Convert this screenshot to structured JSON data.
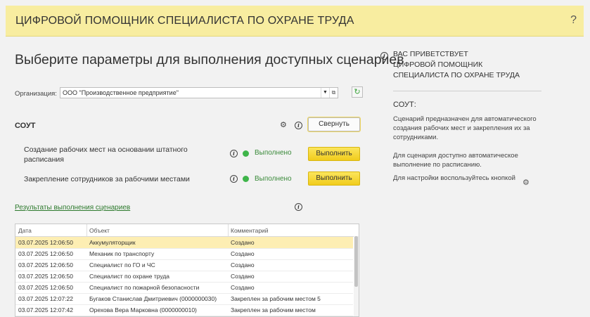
{
  "header": {
    "title": "ЦИФРОВОЙ ПОМОЩНИК СПЕЦИАЛИСТА ПО ОХРАНЕ ТРУДА",
    "help": "?"
  },
  "main": {
    "title": "Выберите параметры для выполнения доступных сценариев",
    "org_label": "Организация:",
    "org_value": "ООО \"Производственное предприятие\""
  },
  "section": {
    "title": "СОУТ",
    "collapse_label": "Свернуть",
    "tasks": [
      {
        "label": "Создание рабочих мест на основании штатного расписания",
        "status": "Выполнено",
        "button": "Выполнить"
      },
      {
        "label": "Закрепление сотрудников за рабочими местами",
        "status": "Выполнено",
        "button": "Выполнить"
      }
    ]
  },
  "results": {
    "link": "Результаты выполнения сценариев",
    "columns": [
      "Дата",
      "Объект",
      "Комментарий"
    ],
    "rows": [
      {
        "date": "03.07.2025 12:06:50",
        "object": "Аккумуляторщик",
        "comment": "Создано"
      },
      {
        "date": "03.07.2025 12:06:50",
        "object": "Механик по транспорту",
        "comment": "Создано"
      },
      {
        "date": "03.07.2025 12:06:50",
        "object": "Специалист по ГО и ЧС",
        "comment": "Создано"
      },
      {
        "date": "03.07.2025 12:06:50",
        "object": "Специалист по охране труда",
        "comment": "Создано"
      },
      {
        "date": "03.07.2025 12:06:50",
        "object": "Специалист по пожарной безопасности",
        "comment": "Создано"
      },
      {
        "date": "03.07.2025 12:07:22",
        "object": "Бугаков Станислав Дмитриевич (0000000030)",
        "comment": "Закреплен за рабочим местом 5"
      },
      {
        "date": "03.07.2025 12:07:42",
        "object": "Орехова Вера Марковна (0000000010)",
        "comment": "Закреплен за рабочим местом"
      }
    ]
  },
  "right_panel": {
    "welcome_line1": "ВАС ПРИВЕТСТВУЕТ",
    "welcome_line2": "ЦИФРОВОЙ ПОМОЩНИК",
    "welcome_line3": "СПЕЦИАЛИСТА ПО ОХРАНЕ ТРУДА",
    "section": "СОУТ:",
    "desc": "Сценарий предназначен для автоматического создания рабочих мест и закрепления их за сотрудниками.",
    "schedule": "Для сценария доступно автоматическое выполнение по расписанию.",
    "settings": "Для настройки воспользуйтесь кнопкой"
  },
  "colors": {
    "header_bg": "#f8eda0",
    "accent_yellow": "#f1cc1c",
    "status_green": "#3fb54a",
    "selected_row": "#fdeeb3"
  }
}
